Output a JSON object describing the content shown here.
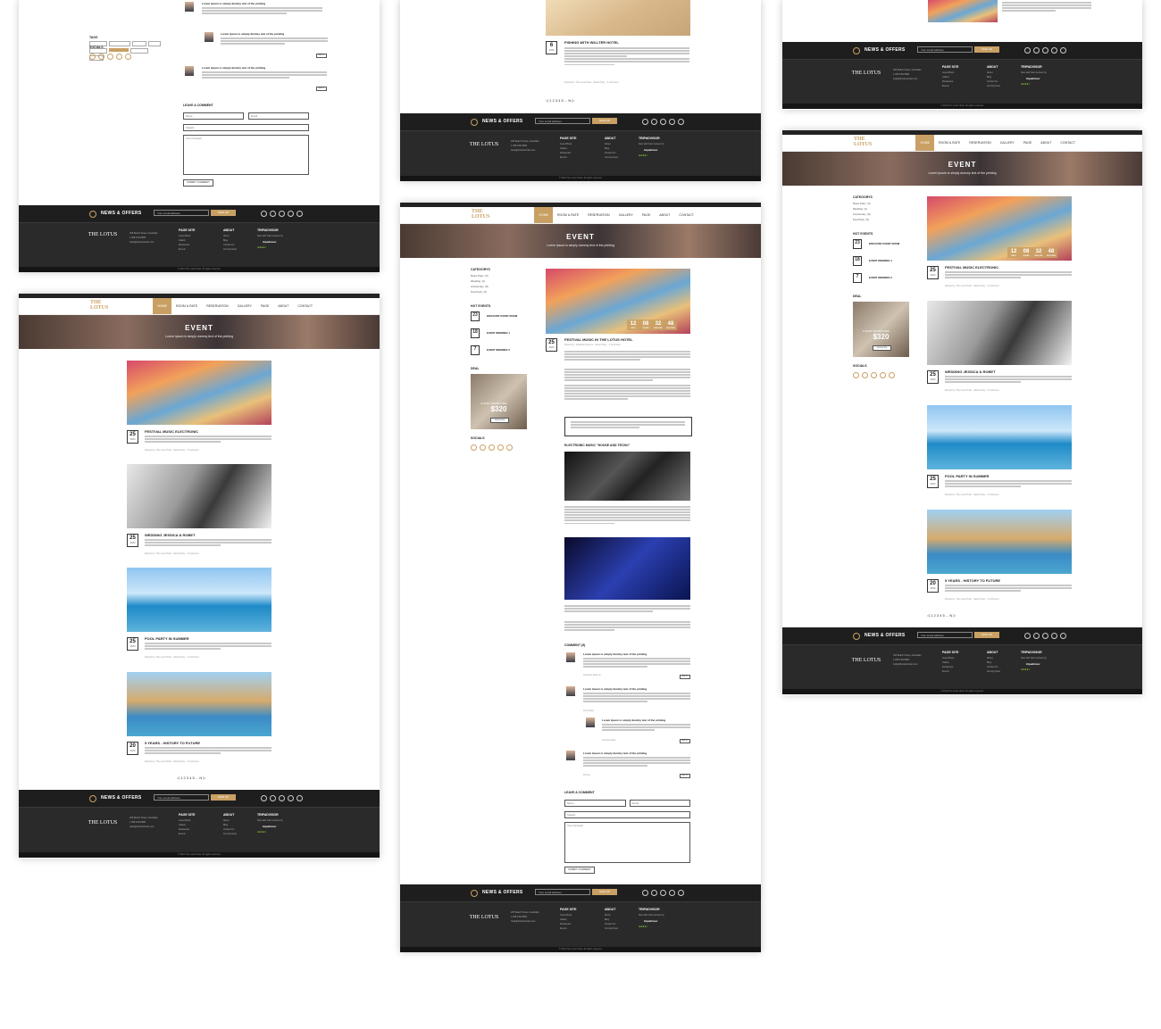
{
  "header": {
    "logo_line1": "THE",
    "logo_line2": "LOTUS",
    "nav": [
      "HOME",
      "ROOM & RATE",
      "RESERVATION",
      "GALLERY",
      "PAGE",
      "ABOUT",
      "CONTACT"
    ]
  },
  "banner": {
    "title": "EVENT",
    "subtitle": "Lorem Ipsum is simply dummy text of the printing"
  },
  "posts": [
    {
      "day": "25",
      "month": "JUN",
      "title": "FESTIVAL MUSIC ELECTRONIC"
    },
    {
      "day": "25",
      "month": "JUN",
      "title": "WEDDING JESSICA & ROBET"
    },
    {
      "day": "25",
      "month": "JUN",
      "title": "POOL PARTY IN SUMMER"
    },
    {
      "day": "20",
      "month": "JUN",
      "title": "5 YEARS - HISTORY TO FUTURE"
    }
  ],
  "post_meta": "Posted by: The Lotus Hotel · Music Party · 3 Comment",
  "blog_post": {
    "day": "6",
    "month": "JUN",
    "title": "FISHING WITH WILLTER HOTEL"
  },
  "detail": {
    "day": "25",
    "month": "JUN",
    "title": "FESTIVAL MUSIC IN THE LOTUS HOTEL",
    "meta": "Posted by: Jonathan Doanne · Music Party · 3 Comment",
    "sub_title": "ELECTRONIC MUSIC \"HOUSE AND TECNO\"",
    "counter": [
      {
        "v": "12",
        "l": "DAYS"
      },
      {
        "v": "08",
        "l": "HOURS"
      },
      {
        "v": "32",
        "l": "MINUTES"
      },
      {
        "v": "48",
        "l": "SECONDS"
      }
    ],
    "comment_head": "COMMENT (5)",
    "comments": [
      {
        "title": "Lorem Ipsum is simply dummy text of the printing",
        "author": "Jonathan Doanne"
      },
      {
        "title": "Lorem Ipsum is simply dummy text of the printing",
        "author": "Anna Moly"
      },
      {
        "title": "Lorem Ipsum is simply dummy text of the printing",
        "author": "Jessica Anika"
      },
      {
        "title": "Lorem Ipsum is simply dummy text of the printing",
        "author": "Tommy"
      }
    ],
    "reply": "REPLY"
  },
  "sidebar": {
    "categories_head": "CATEGORYS",
    "categories": "Music Party  (5)\nWedding  (2)\nAnniversary  (8)\nPool Party  (5)",
    "hot_head": "HOT EVENTS",
    "hot": [
      {
        "day": "23",
        "title": "DISCOUNT EVENT ROOM"
      },
      {
        "day": "18",
        "title": "EVENT WEDDING 1"
      },
      {
        "day": "7",
        "title": "EVENT WEDDING 2"
      }
    ],
    "deal_head": "DEAL",
    "deal_label": "LUXURY ROOM FORM",
    "deal_price": "$320",
    "deal_btn": "VIEW MORE",
    "social_head": "SOCIALS",
    "tags_head": "TAGS"
  },
  "comment_form": {
    "head": "LEAVE A COMMENT",
    "name": "Name",
    "email": "Email",
    "subject": "Subject",
    "message": "Your comment",
    "submit": "SUBMIT COMMENT"
  },
  "newsletter": {
    "title": "NEWS & OFFERS",
    "placeholder": "Your email address",
    "button": "SIGN UP"
  },
  "footer": {
    "logo": "THE LOTUS",
    "address": "225 Beach Street, Australian\n1 068 8 69 8686\nhello@thelotushotel.com",
    "page_site_head": "PAGE SITE",
    "page_site": "Guest Book\nGallery\nRestaurant\nEvents",
    "about_head": "ABOUT",
    "about": "About\nBlog\nContact Us\nComing Soon",
    "trip_head": "TRIPADVISOR",
    "trip_text": "Now with hotel reviews by",
    "trip_brand": "tripadvisor",
    "stars": "●●●●○",
    "copyright": "© 2016 The Lotus Hotel. All rights reserved."
  },
  "pager": "◁  1  2  3  4  5  ...  N  ▷"
}
